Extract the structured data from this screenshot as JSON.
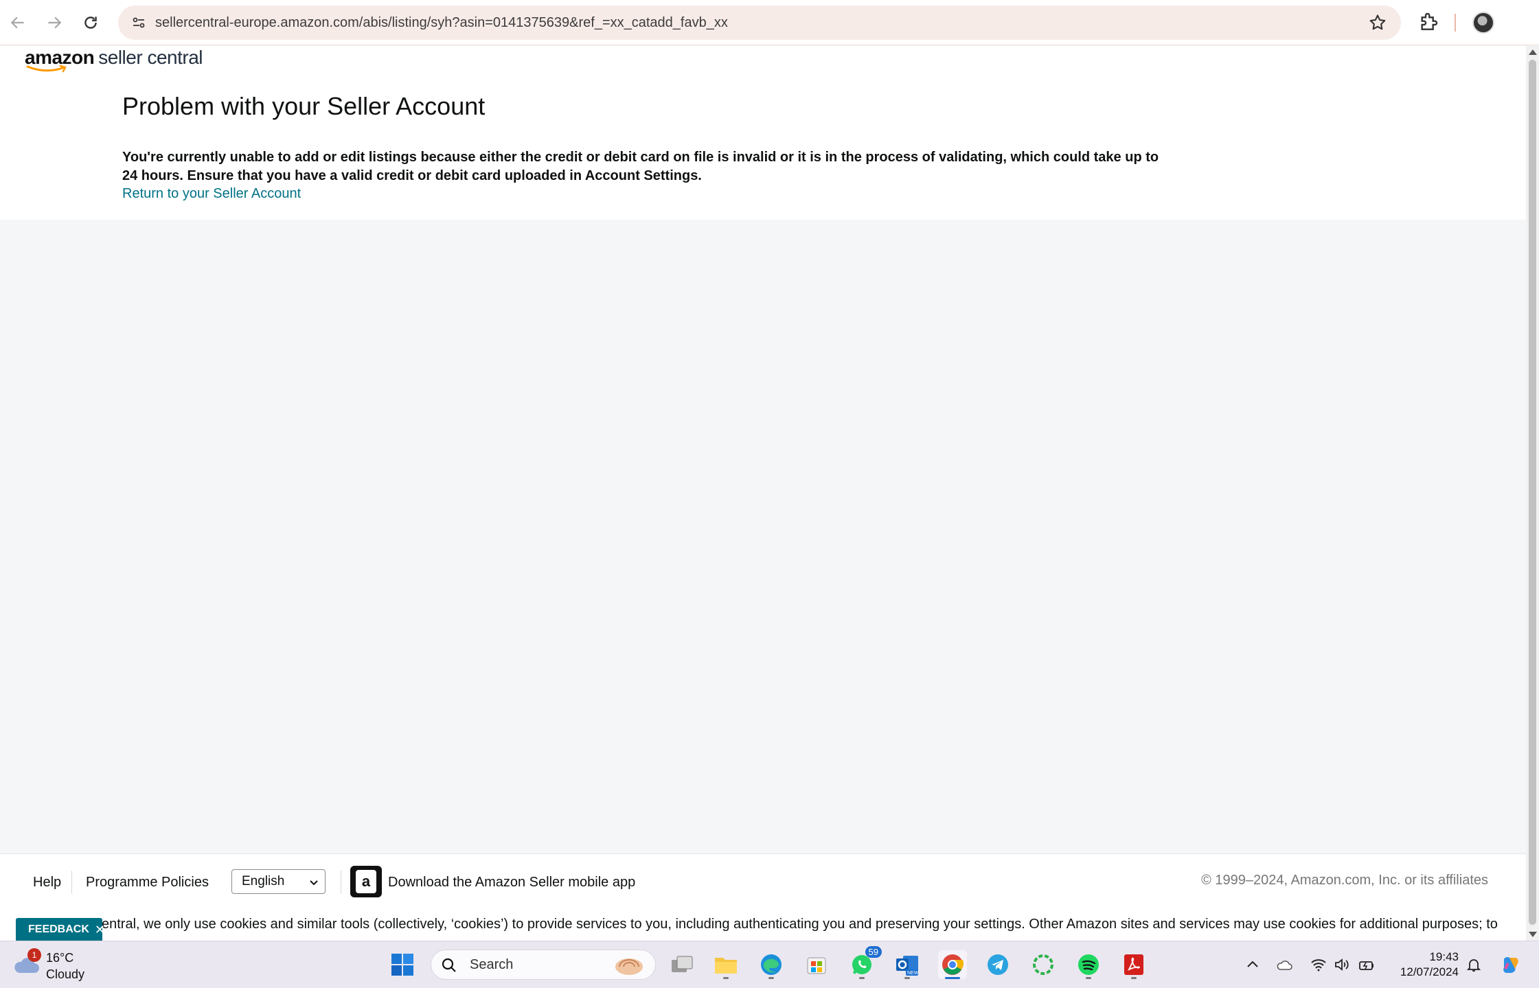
{
  "browser": {
    "url": "sellercentral-europe.amazon.com/abis/listing/syh?asin=0141375639&ref_=xx_catadd_favb_xx"
  },
  "logo": {
    "brand": "amazon",
    "product": "seller central"
  },
  "main": {
    "title": "Problem with your Seller Account",
    "message": "You're currently unable to add or edit listings because either the credit or debit card on file is invalid or it is in the process of validating, which could take up to 24 hours. Ensure that you have a valid credit or debit card uploaded in Account Settings.",
    "return_link": "Return to your Seller Account"
  },
  "footer": {
    "help": "Help",
    "policies": "Programme Policies",
    "language": "English",
    "app_link": "Download the Amazon Seller mobile app",
    "app_icon_letter": "a",
    "copyright": "© 1999–2024, Amazon.com, Inc. or its affiliates",
    "cookie_text": "entral, we only use cookies and similar tools (collectively, ‘cookies’) to provide services to you, including authenticating you and preserving your settings. Other Amazon sites and services may use cookies for additional purposes; to",
    "feedback": "FEEDBACK"
  },
  "taskbar": {
    "weather_temp": "16°C",
    "weather_condition": "Cloudy",
    "weather_badge": "1",
    "search_placeholder": "Search",
    "whatsapp_badge": "59",
    "time": "19:43",
    "date": "12/07/2024"
  },
  "colors": {
    "link": "#007185",
    "feedback_bg": "#007185",
    "page_bg": "#f4f6f7"
  }
}
